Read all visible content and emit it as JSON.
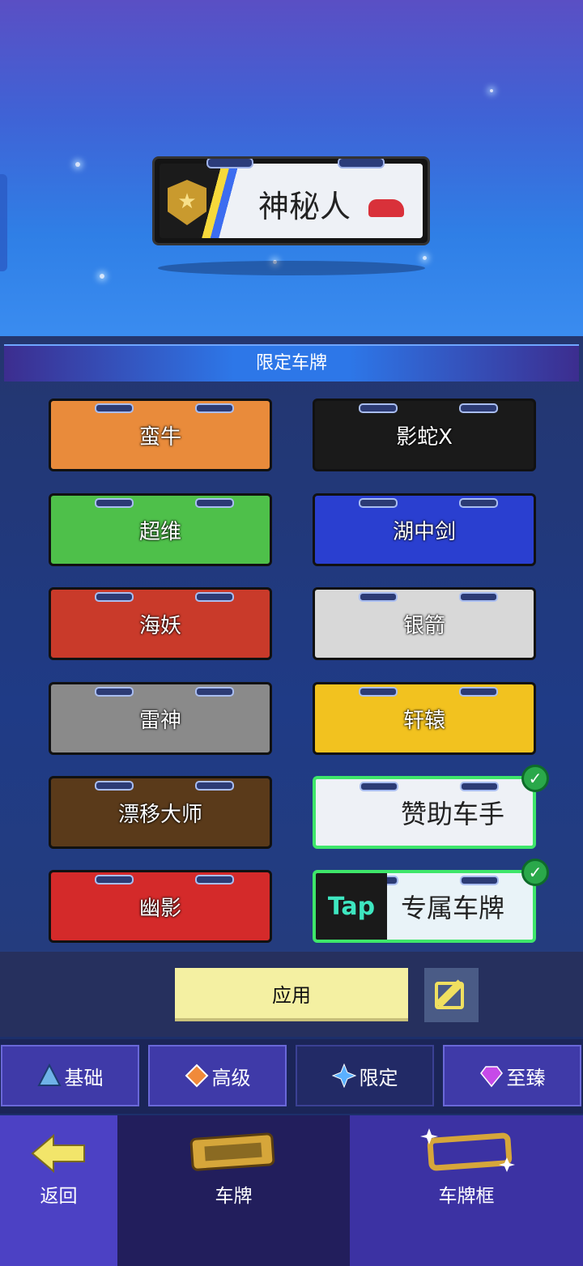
{
  "preview": {
    "plate_text": "神秘人"
  },
  "section": {
    "title": "限定车牌"
  },
  "plates": [
    {
      "label": "蛮牛",
      "selected": false,
      "bg": "#e98b3b"
    },
    {
      "label": "影蛇X",
      "selected": false,
      "bg": "#1a1a1a"
    },
    {
      "label": "超维",
      "selected": false,
      "bg": "#4ec04a"
    },
    {
      "label": "湖中剑",
      "selected": false,
      "bg": "#2a3fd0"
    },
    {
      "label": "海妖",
      "selected": false,
      "bg": "#c93a2a"
    },
    {
      "label": "银箭",
      "selected": false,
      "bg": "#d8d8d8"
    },
    {
      "label": "雷神",
      "selected": false,
      "bg": "#8a8a8a"
    },
    {
      "label": "轩辕",
      "selected": false,
      "bg": "#f2c21f"
    },
    {
      "label": "漂移大师",
      "selected": false,
      "bg": "#5a3a1a"
    },
    {
      "label": "赞助车手",
      "selected": true,
      "bg": "#eef1f6"
    },
    {
      "label": "幽影",
      "selected": false,
      "bg": "#d42a2a"
    },
    {
      "label": "专属车牌",
      "selected": true,
      "bg": "#e9f3f8",
      "logo": "Tap"
    }
  ],
  "actions": {
    "apply_label": "应用"
  },
  "tiers": [
    {
      "label": "基础",
      "icon": "triangle-icon",
      "color": "#6fb2e8"
    },
    {
      "label": "高级",
      "icon": "diamond-icon",
      "color": "#f08a3a"
    },
    {
      "label": "限定",
      "icon": "star-icon",
      "color": "#5ab0ff"
    },
    {
      "label": "至臻",
      "icon": "gem-icon",
      "color": "#c64ae8"
    }
  ],
  "bottom_nav": {
    "back": "返回",
    "plate": "车牌",
    "frame": "车牌框"
  }
}
